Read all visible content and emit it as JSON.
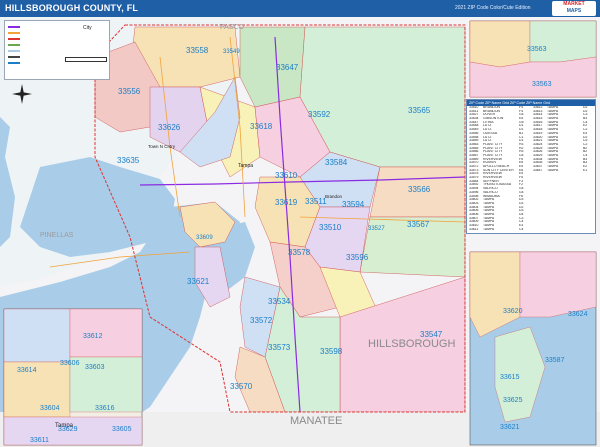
{
  "header": {
    "title": "HILLSBOROUGH COUNTY, FL",
    "edition": "2021 ZIP Code Color/Cute Edition",
    "logo_line1": "MARKET",
    "logo_line2": "MAPS",
    "logo_line3": "Market Maps"
  },
  "legend": {
    "city_label": "City",
    "scale_label": "Miles"
  },
  "map": {
    "county_labels": [
      "HILLSBOROUGH",
      "MANATEE",
      "PINELLAS",
      "PASCO"
    ],
    "city_labels": [
      "Tampa",
      "Town N Cntry",
      "Brandon",
      "Tampa"
    ],
    "zip_labels": [
      "33558",
      "33549",
      "33647",
      "33556",
      "33592",
      "33565",
      "33626",
      "33635",
      "33618",
      "33610",
      "33584",
      "33566",
      "33619",
      "33511",
      "33594",
      "33527",
      "33510",
      "33567",
      "33609",
      "33578",
      "33596",
      "33572",
      "33534",
      "33547",
      "33573",
      "33598",
      "33570",
      "33621",
      "33612",
      "33614",
      "33606",
      "33603",
      "33604",
      "33605",
      "33611",
      "33616",
      "33629",
      "33563",
      "33563",
      "33620",
      "33624",
      "33615",
      "33587",
      "33625",
      "33621"
    ]
  },
  "zip_table": {
    "header": "ZIP Code   ZIP Name   Grid   ZIP Code   ZIP Name   Grid",
    "left": [
      [
        "33510",
        "BRANDON",
        "F4"
      ],
      [
        "33511",
        "BRANDON",
        "F4"
      ],
      [
        "33527",
        "DOVER",
        "G4"
      ],
      [
        "33534",
        "GIBSONTON",
        "E5"
      ],
      [
        "33547",
        "LITHIA",
        "G5"
      ],
      [
        "33548",
        "LUTZ",
        "D1"
      ],
      [
        "33549",
        "LUTZ",
        "D1"
      ],
      [
        "33556",
        "ODESSA",
        "B1"
      ],
      [
        "33558",
        "LUTZ",
        "C1"
      ],
      [
        "33559",
        "LUTZ",
        "D1"
      ],
      [
        "33563",
        "PLANT CITY",
        "H3"
      ],
      [
        "33565",
        "PLANT CITY",
        "H2"
      ],
      [
        "33566",
        "PLANT CITY",
        "H3"
      ],
      [
        "33567",
        "PLANT CITY",
        "G4"
      ],
      [
        "33569",
        "RIVERVIEW",
        "F5"
      ],
      [
        "33570",
        "RUSKIN",
        "E6"
      ],
      [
        "33572",
        "APOLLO BEACH",
        "E5"
      ],
      [
        "33573",
        "SUN CITY CENTER",
        "E6"
      ],
      [
        "33578",
        "RIVERVIEW",
        "E5"
      ],
      [
        "33579",
        "RIVERVIEW",
        "F5"
      ],
      [
        "33584",
        "SEFFNER",
        "F3"
      ],
      [
        "33592",
        "THONOTOSASSA",
        "F2"
      ],
      [
        "33594",
        "VALRICO",
        "G4"
      ],
      [
        "33596",
        "VALRICO",
        "G4"
      ],
      [
        "33598",
        "WIMAUMA",
        "F6"
      ],
      [
        "33602",
        "TAMPA",
        "D3"
      ],
      [
        "33603",
        "TAMPA",
        "D3"
      ],
      [
        "33604",
        "TAMPA",
        "D2"
      ],
      [
        "33605",
        "TAMPA",
        "D3"
      ],
      [
        "33606",
        "TAMPA",
        "D4"
      ],
      [
        "33607",
        "TAMPA",
        "C3"
      ],
      [
        "33609",
        "TAMPA",
        "C4"
      ],
      [
        "33610",
        "TAMPA",
        "E3"
      ],
      [
        "33611",
        "TAMPA",
        "C4"
      ]
    ],
    "right": [
      [
        "33612",
        "TAMPA",
        "D2"
      ],
      [
        "33613",
        "TAMPA",
        "D2"
      ],
      [
        "33614",
        "TAMPA",
        "C3"
      ],
      [
        "33615",
        "TAMPA",
        "B3"
      ],
      [
        "33616",
        "TAMPA",
        "C4"
      ],
      [
        "33617",
        "TAMPA",
        "E2"
      ],
      [
        "33618",
        "TAMPA",
        "C2"
      ],
      [
        "33619",
        "TAMPA",
        "E4"
      ],
      [
        "33620",
        "TAMPA",
        "D2"
      ],
      [
        "33621",
        "TAMPA",
        "C5"
      ],
      [
        "33624",
        "TAMPA",
        "C2"
      ],
      [
        "33625",
        "TAMPA",
        "B2"
      ],
      [
        "33626",
        "TAMPA",
        "B2"
      ],
      [
        "33629",
        "TAMPA",
        "C4"
      ],
      [
        "33634",
        "TAMPA",
        "B3"
      ],
      [
        "33635",
        "TAMPA",
        "B3"
      ],
      [
        "33637",
        "TAMPA",
        "E2"
      ],
      [
        "33647",
        "TAMPA",
        "E1"
      ]
    ]
  },
  "colors": {
    "header_bg": "#1f5fa6",
    "water": "#a9cde9",
    "zip_label": "#1a7fc8"
  }
}
